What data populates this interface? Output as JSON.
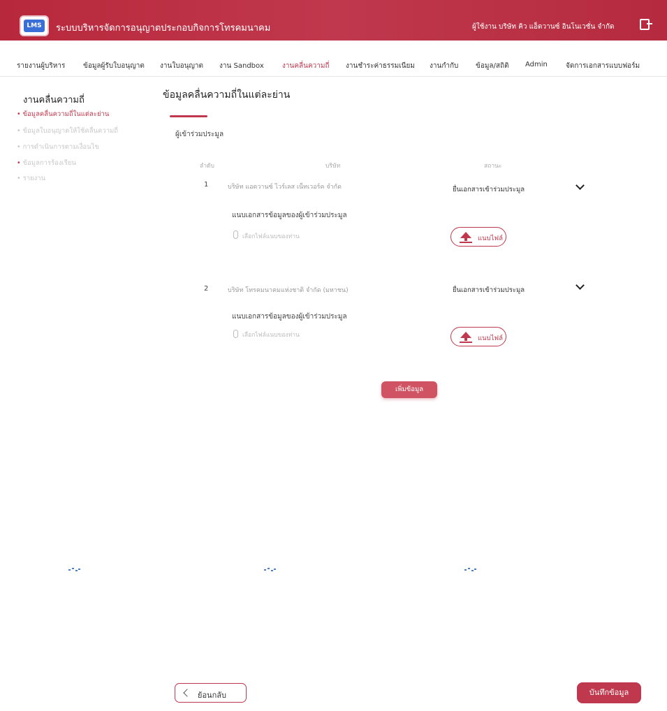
{
  "header": {
    "logo_text": "LMS",
    "app_title": "ระบบบริหารจัดการอนุญาตประกอบกิจการโทรคมนาคม",
    "user_info": "ผู้ใช้งาน บริษัท คิว แอ็ดวานซ์ อินโนเวชั่น จำกัด",
    "brand_color": "#c0384d"
  },
  "menu": {
    "items": [
      {
        "label": "รายงานผู้บริหาร"
      },
      {
        "label": "ข้อมูลผู้รับใบอนุญาต"
      },
      {
        "label": "งานใบอนุญาต"
      },
      {
        "label": "งาน Sandbox"
      },
      {
        "label": "งานคลื่นความถี่"
      },
      {
        "label": "งานชำระค่าธรรมเนียม"
      },
      {
        "label": "งานกำกับ"
      },
      {
        "label": "ข้อมูล/สถิติ"
      },
      {
        "label": "Admin"
      },
      {
        "label": "จัดการเอกสารแบบฟอร์ม"
      }
    ],
    "active_index": 4
  },
  "sidebar": {
    "title": "งานคลื่นความถี่",
    "items": [
      {
        "label": "ข้อมูลคลื่นความถี่ในแต่ละย่าน"
      },
      {
        "label": "ข้อมูลใบอนุญาตให้ใช้คลื่นความถี่"
      },
      {
        "label": "การดำเนินการตามเงื่อนไข"
      },
      {
        "label": "ข้อมูลการร้องเรียน"
      },
      {
        "label": "รายงาน"
      }
    ]
  },
  "main": {
    "title": "ข้อมูลคลื่นความถี่ในแต่ละย่าน",
    "tab_label": "ผู้เข้าร่วมประมูล",
    "table": {
      "headers": {
        "no": "ลำดับ",
        "company": "บริษัท",
        "status": "สถานะ"
      },
      "rows": [
        {
          "no": "1",
          "company": "บริษัท แอดวานซ์ ไวร์เลส เน็ทเวอร์ค จำกัด",
          "status": "ยื่นเอกสารเข้าร่วมประมูล",
          "attach_label": "แนบเอกสารข้อมูลของผู้เข้าร่วมประมูล",
          "file_hint": "เลือกไฟล์แนบของท่าน",
          "upload_label": "แนบไฟล์"
        },
        {
          "no": "2",
          "company": "บริษัท โทรคมนาคมแห่งชาติ จำกัด (มหาชน)",
          "status": "ยื่นเอกสารเข้าร่วมประมูล",
          "attach_label": "แนบเอกสารข้อมูลของผู้เข้าร่วมประมูล",
          "file_hint": "เลือกไฟล์แนบของท่าน",
          "upload_label": "แนบไฟล์"
        }
      ]
    },
    "add_button": "เพิ่มข้อมูล"
  },
  "footer": {
    "back_label": "ย้อนกลับ",
    "save_label": "บันทึกข้อมูล"
  }
}
